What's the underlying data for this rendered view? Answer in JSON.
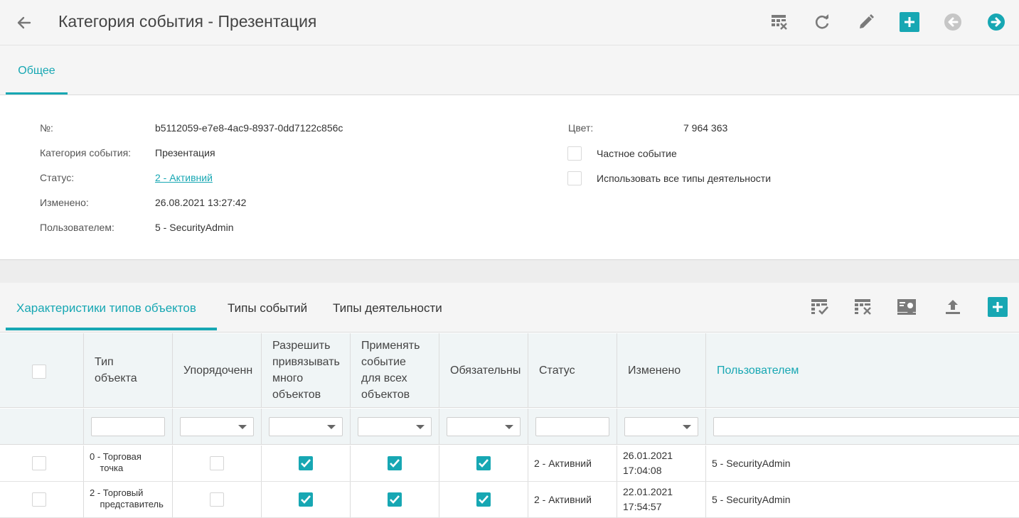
{
  "header": {
    "title": "Категория события - Презентация"
  },
  "tabs_main": {
    "general": "Общее"
  },
  "details": {
    "number_label": "№:",
    "number_value": "b5112059-e7e8-4ac9-8937-0dd7122c856c",
    "category_label": "Категория события:",
    "category_value": "Презентация",
    "status_label": "Статус:",
    "status_value": "2 - Активний",
    "changed_label": "Изменено:",
    "changed_value": "26.08.2021 13:27:42",
    "user_label": "Пользователем:",
    "user_value": "5 - SecurityAdmin",
    "color_label": "Цвет:",
    "color_value": "7 964 363",
    "private_label": "Частное событие",
    "all_types_label": "Использовать все типы деятельности"
  },
  "tabs_sub": {
    "object_props": "Характеристики типов объектов",
    "event_types": "Типы событий",
    "activity_types": "Типы деятельности"
  },
  "table": {
    "columns": [
      "Тип\nобъекта",
      "Упорядоченн",
      "Разрешить\nпривязывать\nмного\nобъектов",
      "Применять\nсобытие\nдля всех\nобъектов",
      "Обязательны",
      "Статус",
      "Изменено",
      "Пользователем"
    ],
    "rows": [
      {
        "type": "0 - Торговая\n    точка",
        "ordered": false,
        "multi": true,
        "apply_all": true,
        "required": true,
        "status": "2 - Активний",
        "changed_date": "26.01.2021",
        "changed_time": "17:04:08",
        "user": "5 - SecurityAdmin"
      },
      {
        "type": "2 - Торговый\n    представитель",
        "ordered": false,
        "multi": true,
        "apply_all": true,
        "required": true,
        "status": "2 - Активний",
        "changed_date": "22.01.2021",
        "changed_time": "17:54:57",
        "user": "5 - SecurityAdmin"
      }
    ]
  },
  "colors": {
    "accent": "#17a7b3",
    "header_bg": "#f5f5f5",
    "grid_header_bg": "#f0f5f6"
  },
  "icons": {
    "header_toolbar": [
      "table-clear-icon",
      "refresh-icon",
      "edit-icon",
      "add-icon",
      "previous-icon",
      "next-icon"
    ],
    "grid_toolbar": [
      "table-check-icon",
      "table-clear-icon",
      "user-card-icon",
      "upload-icon",
      "add-icon"
    ]
  }
}
